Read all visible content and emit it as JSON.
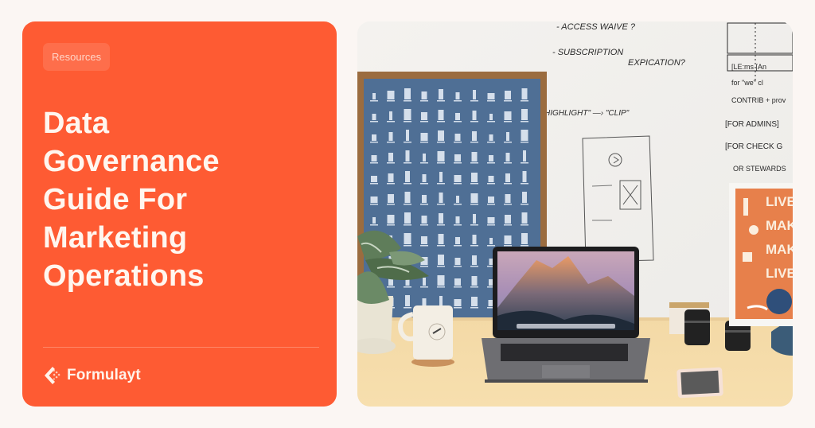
{
  "card": {
    "category_badge": "Resources",
    "title_lines": [
      "Data",
      "Governance",
      "Guide For",
      "Marketing",
      "Operations"
    ],
    "brand": {
      "name": "Formulayt",
      "icon": "formulayt-logo-icon"
    },
    "accent_color": "#fe5b33"
  },
  "photo": {
    "description": "Desk workspace with laptop, plant, mug, camera lenses, phone, framed landmark poster and whiteboard notes",
    "whiteboard_notes": [
      "- ACCESS WAIVE?",
      "- SUBSCRIPTION EXPIRATION?",
      "HIGHLIGHT\" -> \"CLIP\"",
      "[FOR ADMINS]",
      "[FOR CHECK",
      "OR STEWARDS"
    ],
    "poster_words": [
      "LIVE",
      "MAKE",
      "MAKE",
      "LIVE"
    ]
  }
}
